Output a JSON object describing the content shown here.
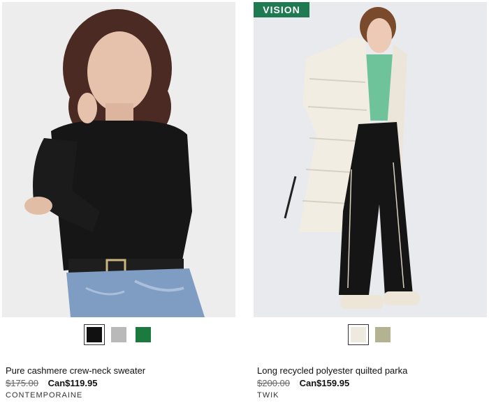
{
  "products": [
    {
      "name": "Pure cashmere crew-neck sweater",
      "old_price": "$175.00",
      "new_price": "Can$119.95",
      "brand": "CONTEMPORAINE",
      "swatches": [
        {
          "color": "#111111",
          "selected": true
        },
        {
          "color": "#b9b9b9",
          "selected": false
        },
        {
          "color": "#1b7a3e",
          "selected": false
        }
      ]
    },
    {
      "badge": "VISION",
      "name": "Long recycled polyester quilted parka",
      "old_price": "$200.00",
      "new_price": "Can$159.95",
      "brand": "TWIK",
      "swatches": [
        {
          "color": "#eeeae0",
          "selected": true
        },
        {
          "color": "#b3b291",
          "selected": false
        }
      ]
    }
  ]
}
